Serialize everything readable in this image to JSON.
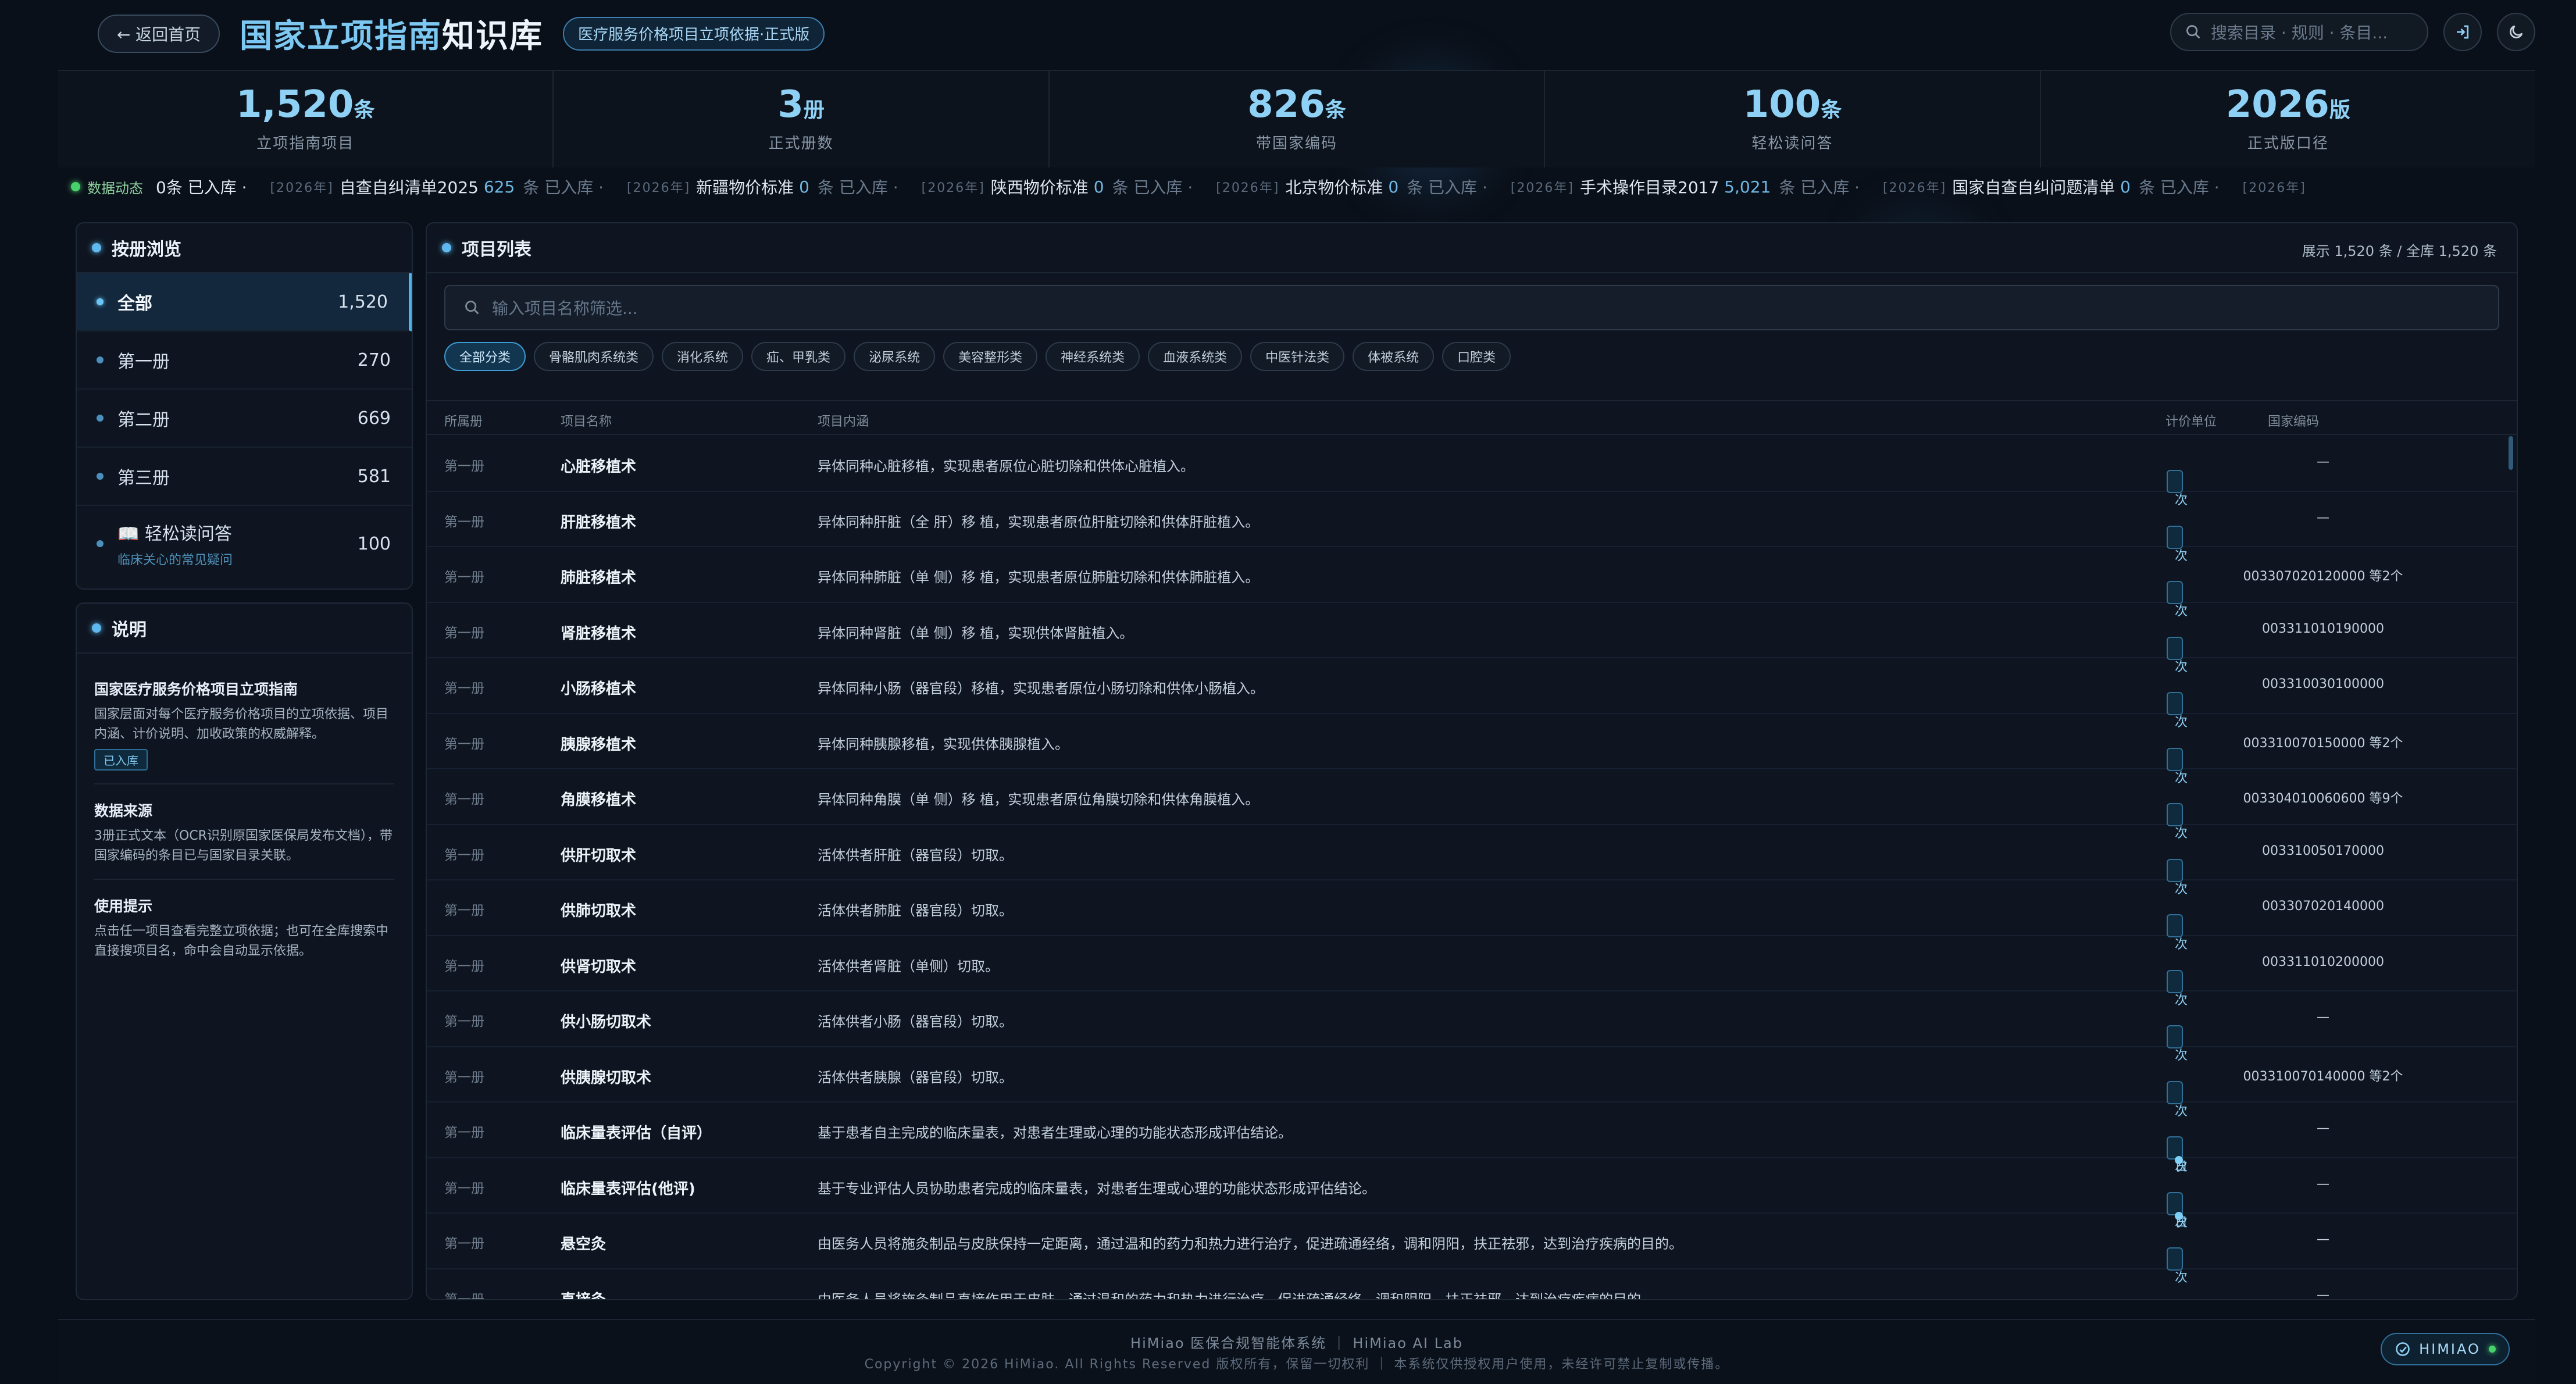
{
  "header": {
    "back_label": "← 返回首页",
    "title_accent": "国家立项指南",
    "title_plain": "知识库",
    "edition_badge": "医疗服务价格项目立项依据·正式版",
    "search_placeholder": "搜索目录 · 规则 · 条目..."
  },
  "stats": [
    {
      "value": "1,520",
      "unit": "条",
      "label": "立项指南项目"
    },
    {
      "value": "3",
      "unit": "册",
      "label": "正式册数"
    },
    {
      "value": "826",
      "unit": "条",
      "label": "带国家编码"
    },
    {
      "value": "100",
      "unit": "条",
      "label": "轻松读问答"
    },
    {
      "value": "2026",
      "unit": "版",
      "label": "正式版口径"
    }
  ],
  "ticker": {
    "tag": "数据动态",
    "lead": "0条 已入库 ·",
    "items": [
      {
        "year": "[2026年]",
        "name": "自查自纠清单2025",
        "num": "625",
        "suffix": "条 已入库 ·"
      },
      {
        "year": "[2026年]",
        "name": "新疆物价标准",
        "num": "0",
        "suffix": "条 已入库 ·"
      },
      {
        "year": "[2026年]",
        "name": "陕西物价标准",
        "num": "0",
        "suffix": "条 已入库 ·"
      },
      {
        "year": "[2026年]",
        "name": "北京物价标准",
        "num": "0",
        "suffix": "条 已入库 ·"
      },
      {
        "year": "[2026年]",
        "name": "手术操作目录2017",
        "num": "5,021",
        "suffix": "条 已入库 ·"
      },
      {
        "year": "[2026年]",
        "name": "国家自查自纠问题清单",
        "num": "0",
        "suffix": "条 已入库 ·"
      },
      {
        "year": "[2026年]",
        "name": "",
        "num": "",
        "suffix": ""
      }
    ]
  },
  "browse": {
    "title": "按册浏览",
    "items": [
      {
        "name": "全部",
        "count": "1,520"
      },
      {
        "name": "第一册",
        "count": "270"
      },
      {
        "name": "第二册",
        "count": "669"
      },
      {
        "name": "第三册",
        "count": "581"
      },
      {
        "name": "📖 轻松读问答",
        "sub": "临床关心的常见疑问",
        "count": "100"
      }
    ]
  },
  "notes": {
    "title": "说明",
    "blocks": [
      {
        "title": "国家医疗服务价格项目立项指南",
        "body": "国家层面对每个医疗服务价格项目的立项依据、项目内涵、计价说明、加收政策的权威解释。",
        "tag": "已入库"
      },
      {
        "title": "数据来源",
        "body": "3册正式文本（OCR识别原国家医保局发布文档），带国家编码的条目已与国家目录关联。"
      },
      {
        "title": "使用提示",
        "body": "点击任一项目查看完整立项依据；也可在全库搜索中直接搜项目名，命中会自动显示依据。"
      }
    ]
  },
  "list": {
    "title": "项目列表",
    "count_text": "展示 1,520 条 / 全库 1,520 条",
    "filter_placeholder": "输入项目名称筛选...",
    "chips": [
      "全部分类",
      "骨骼肌肉系统类",
      "消化系统",
      "疝、甲乳类",
      "泌尿系统",
      "美容整形类",
      "神经系统类",
      "血液系统类",
      "中医针法类",
      "体被系统",
      "口腔类"
    ],
    "columns": [
      "所属册",
      "项目名称",
      "项目内涵",
      "计价单位",
      "国家编码"
    ],
    "rows": [
      {
        "vol": "第一册",
        "name": "心脏移植术",
        "desc": "异体同种心脏移植，实现患者原位心脏切除和供体心脏植入。",
        "unit": "次",
        "unit2": "",
        "code": "—"
      },
      {
        "vol": "第一册",
        "name": "肝脏移植术",
        "desc": "异体同种肝脏（全 肝）移 植，实现患者原位肝脏切除和供体肝脏植入。",
        "unit": "次",
        "unit2": "",
        "code": "—"
      },
      {
        "vol": "第一册",
        "name": "肺脏移植术",
        "desc": "异体同种肺脏（单 侧）移 植，实现患者原位肺脏切除和供体肺脏植入。",
        "unit": "次",
        "unit2": "",
        "code": "003307020120000 等2个"
      },
      {
        "vol": "第一册",
        "name": "肾脏移植术",
        "desc": "异体同种肾脏（单 侧）移 植，实现供体肾脏植入。",
        "unit": "次",
        "unit2": "",
        "code": "003311010190000"
      },
      {
        "vol": "第一册",
        "name": "小肠移植术",
        "desc": "异体同种小肠（器官段）移植，实现患者原位小肠切除和供体小肠植入。",
        "unit": "次",
        "unit2": "",
        "code": "003310030100000"
      },
      {
        "vol": "第一册",
        "name": "胰腺移植术",
        "desc": "异体同种胰腺移植，实现供体胰腺植入。",
        "unit": "次",
        "unit2": "",
        "code": "003310070150000 等2个"
      },
      {
        "vol": "第一册",
        "name": "角膜移植术",
        "desc": "异体同种角膜（单 侧）移 植，实现患者原位角膜切除和供体角膜植入。",
        "unit": "次",
        "unit2": "",
        "code": "003304010060600 等9个"
      },
      {
        "vol": "第一册",
        "name": "供肝切取术",
        "desc": "活体供者肝脏（器官段）切取。",
        "unit": "次",
        "unit2": "",
        "code": "003310050170000"
      },
      {
        "vol": "第一册",
        "name": "供肺切取术",
        "desc": "活体供者肺脏（器官段）切取。",
        "unit": "次",
        "unit2": "",
        "code": "003307020140000"
      },
      {
        "vol": "第一册",
        "name": "供肾切取术",
        "desc": "活体供者肾脏（单侧）切取。",
        "unit": "次",
        "unit2": "",
        "code": "003311010200000"
      },
      {
        "vol": "第一册",
        "name": "供小肠切取术",
        "desc": "活体供者小肠（器官段）切取。",
        "unit": "次",
        "unit2": "",
        "code": "—"
      },
      {
        "vol": "第一册",
        "name": "供胰腺切取术",
        "desc": "活体供者胰腺（器官段）切取。",
        "unit": "次",
        "unit2": "",
        "code": "003310070140000 等2个"
      },
      {
        "vol": "第一册",
        "name": "临床量表评估（自评）",
        "desc": "基于患者自主完成的临床量表，对患者生理或心理的功能状态形成评估结论。",
        "unit": "次",
        "unit2": "日",
        "code": "—"
      },
      {
        "vol": "第一册",
        "name": "临床量表评估(他评)",
        "desc": "基于专业评估人员协助患者完成的临床量表，对患者生理或心理的功能状态形成评估结论。",
        "unit": "次",
        "unit2": "日",
        "code": "—"
      },
      {
        "vol": "第一册",
        "name": "悬空灸",
        "desc": "由医务人员将施灸制品与皮肤保持一定距离，通过温和的药力和热力进行治疗，促进疏通经络，调和阴阳，扶正祛邪，达到治疗疾病的目的。",
        "unit": "次",
        "unit2": "",
        "code": "—"
      },
      {
        "vol": "第一册",
        "name": "直接灸",
        "desc": "由医务人员将施灸制品直接作用于皮肤，通过温和的药力和热力进行治疗，促进疏通经络，调和阴阳，扶正祛邪，达到治疗疾病的目的。",
        "unit": "次",
        "unit2": "",
        "code": "—"
      }
    ]
  },
  "footer": {
    "line1": "HiMiao 医保合规智能体系统  ｜  HiMiao AI Lab",
    "line2": "Copyright © 2026 HiMiao. All Rights Reserved  版权所有，保留一切权利  ｜  本系统仅供授权用户使用，未经许可禁止复制或传播。",
    "brand": "HIMIAO"
  },
  "colors": {
    "accent": "#7cc8f2",
    "background": "#0a1019",
    "status_green": "#47d16c"
  }
}
